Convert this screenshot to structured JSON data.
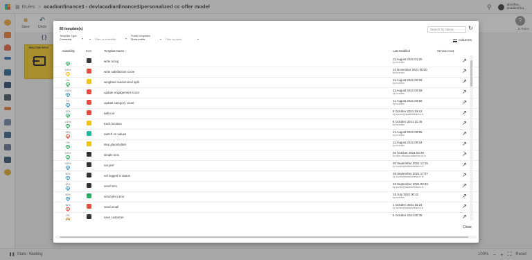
{
  "app": {
    "breadcrumb_root": "Rules",
    "breadcrumb_path": "acadianfinance3 - dev/acadianfinance3/personalized cc offer model",
    "user_name": "abcefba...",
    "user_org": "acadianfina..."
  },
  "toolbar": {
    "save_label": "Save",
    "undo_label": "Undo",
    "help_label": "D Rules"
  },
  "canvas": {
    "node_title": "REALTIME INPUT"
  },
  "status": {
    "label": "State: Waiting",
    "zoom": "100%",
    "reset_label": "Reset"
  },
  "modal": {
    "title": "80 template(s)",
    "search_placeholder": "Search by Name",
    "filters": [
      {
        "label": "Template Type",
        "value": "Connector"
      },
      {
        "label": "",
        "value": "Filter on suitability"
      },
      {
        "label": "Public templates",
        "value": "Show public"
      },
      {
        "label": "",
        "value": "Filter by client"
      }
    ],
    "columns_label": "Columns",
    "close_label": "Close",
    "headers": {
      "suitability": "Suitability",
      "icon": "Icon",
      "name": "Template Name ↓",
      "modified": "Last Modified",
      "cost": "Service Cost"
    },
    "rows": [
      {
        "name": "write to log",
        "pct": "100%",
        "face": "#27ae60",
        "icon": "#3a3a3a",
        "date": "11 August 2021 01:30",
        "by": "by incentivi"
      },
      {
        "name": "write satisfaction score",
        "pct": "0%",
        "face": "#f1c40f",
        "icon": "#e74c3c",
        "date": "10 November 2021 00:00",
        "by": "by incentivi"
      },
      {
        "name": "weighted randomized split",
        "pct": "100%",
        "face": "#27ae60",
        "icon": "#f1c40f",
        "date": "11 August 2021 00:59",
        "by": "by incentivi"
      },
      {
        "name": "update engagement score",
        "pct": "0%",
        "face": "#3498db",
        "icon": "#e74c3c",
        "date": "11 August 2021 00:58",
        "by": "by incentivi"
      },
      {
        "name": "update category count",
        "pct": "47%",
        "face": "#3498db",
        "icon": "#e74c3c",
        "date": "11 August 2021 00:58",
        "by": "by incentivi"
      },
      {
        "name": "twilio ivr",
        "pct": "100%",
        "face": "#27ae60",
        "icon": "#e74c3c",
        "date": "8 October 2021 15:12",
        "by": "by suzam@acadianfinance.in"
      },
      {
        "name": "track location",
        "pct": "78%",
        "face": "#27ae60",
        "icon": "#f1c40f",
        "date": "8 October 2021 21:45",
        "by": "by incentivi"
      },
      {
        "name": "switch on values",
        "pct": "0%",
        "face": "#e74c3c",
        "icon": "#1abc9c",
        "date": "11 August 2021 00:55",
        "by": "by incentivi"
      },
      {
        "name": "step placeholder",
        "pct": "100%",
        "face": "#27ae60",
        "icon": "#f1c40f",
        "date": "11 August 2021 00:54",
        "by": "by incentivi"
      },
      {
        "name": "simple sms",
        "pct": "100%",
        "face": "#27ae60",
        "icon": "#333333",
        "date": "20 October 2021 02:36",
        "by": "by fase.cella@acadianfina.co.in"
      },
      {
        "name": "set pref",
        "pct": "30%",
        "face": "#3498db",
        "icon": "#333333",
        "date": "30 September 2021 12:15",
        "by": "by suzam@acadianfinance.in"
      },
      {
        "name": "set logged in status",
        "pct": "50%",
        "face": "#3498db",
        "icon": "#333333",
        "date": "28 September 2021 17:07",
        "by": "by suzam@acadianfinance.in"
      },
      {
        "name": "send sms",
        "pct": "50%",
        "face": "#3498db",
        "icon": "#333333",
        "date": "30 September 2021 00:33",
        "by": "by suzam@acadianfinance.in"
      },
      {
        "name": "send plivo sms",
        "pct": "50%",
        "face": "#3498db",
        "icon": "#27ae60",
        "date": "15 July 2020 00:42",
        "by": "by incentivi"
      },
      {
        "name": "send email",
        "pct": "0%",
        "face": "#e74c3c",
        "icon": "#e74c3c",
        "date": "1 October 2021 15:24",
        "by": "by suzam@acadianfinance.in"
      },
      {
        "name": "save customer",
        "pct": "",
        "face": "#e67e22",
        "icon": "#333333",
        "date": "5 October 2021 00:36",
        "by": ""
      }
    ]
  }
}
